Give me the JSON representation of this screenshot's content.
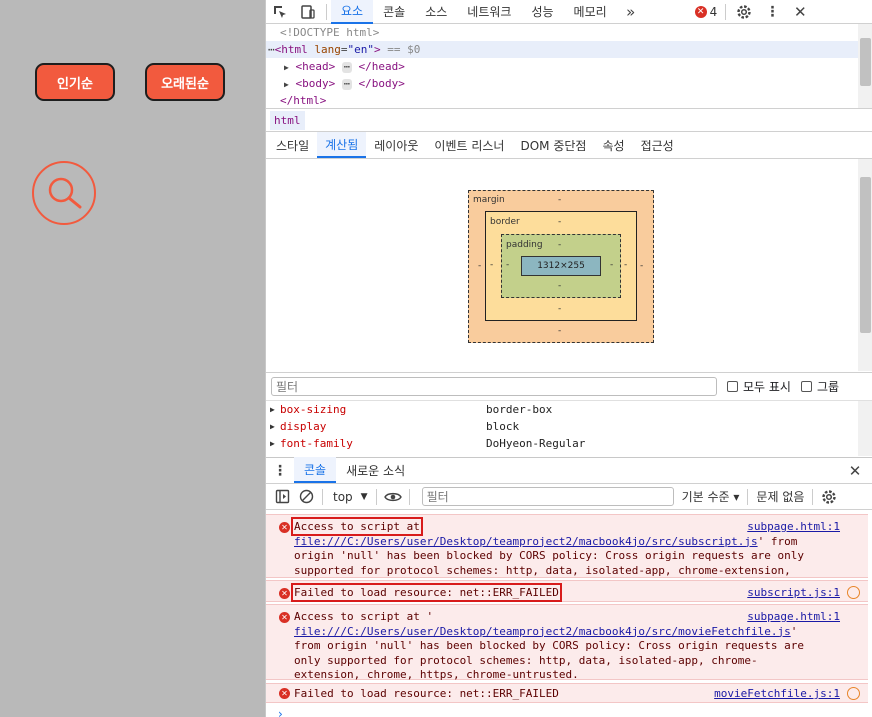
{
  "page": {
    "buttons": [
      {
        "label": "인기순"
      },
      {
        "label": "오래된순"
      }
    ]
  },
  "devtools": {
    "main_tabs": [
      "요소",
      "콘솔",
      "소스",
      "네트워크",
      "성능",
      "메모리"
    ],
    "active_main_tab": "요소",
    "more_tabs_glyph": "»",
    "error_count": "4",
    "dom": {
      "doctype": "<!DOCTYPE html>",
      "html_open_prefix": "<html ",
      "html_attr_name": "lang",
      "html_attr_value": "\"en\"",
      "html_open_suffix": ">",
      "html_marker": "== $0",
      "head_open": "<head>",
      "head_close": "</head>",
      "body_open": "<body>",
      "body_close": "</body>",
      "html_close": "</html>",
      "ellipsis": "⋯"
    },
    "breadcrumb": "html",
    "sub_tabs": [
      "스타일",
      "계산됨",
      "레이아웃",
      "이벤트 리스너",
      "DOM 중단점",
      "속성",
      "접근성"
    ],
    "active_sub_tab": "계산됨",
    "box_model": {
      "margin_label": "margin",
      "border_label": "border",
      "padding_label": "padding",
      "dash": "-",
      "content_size": "1312×255"
    },
    "computed_filter_placeholder": "필터",
    "show_all_label": "모두 표시",
    "group_label": "그룹",
    "properties": [
      {
        "name": "box-sizing",
        "value": "border-box"
      },
      {
        "name": "display",
        "value": "block"
      },
      {
        "name": "font-family",
        "value": "DoHyeon-Regular"
      }
    ],
    "drawer_tabs": [
      "콘솔",
      "새로운 소식"
    ],
    "active_drawer_tab": "콘솔",
    "console_toolbar": {
      "context": "top",
      "filter_placeholder": "필터",
      "levels": "기본 수준 ▾",
      "issues": "문제 없음"
    },
    "messages": [
      {
        "first": "Access to script at",
        "link": "file:///C:/Users/user/Desktop/teamproject2/macbook4jo/src/subscript.js",
        "rest": "' from origin 'null' has been blocked by CORS policy: Cross origin requests are only supported for protocol schemes: http, data, isolated-app, chrome-extension, chrome, https, chrome-untrusted.",
        "source": "subpage.html:1"
      },
      {
        "first": "Failed to load resource: net::ERR_FAILED",
        "source": "subscript.js:1"
      },
      {
        "first": "Access to script at '",
        "link": "file:///C:/Users/user/Desktop/teamproject2/macbook4jo/src/movieFetchfile.js",
        "rest": "' from origin 'null' has been blocked by CORS policy: Cross origin requests are only supported for protocol schemes: http, data, isolated-app, chrome-extension, chrome, https, chrome-untrusted.",
        "source": "subpage.html:1"
      },
      {
        "first": "Failed to load resource: net::ERR_FAILED",
        "source": "movieFetchfile.js:1"
      }
    ],
    "prompt": "›"
  },
  "colors": {
    "accent_orange": "#f25a3e",
    "devtools_blue": "#1a73e8",
    "error_red": "#d93025",
    "highlight_red": "#d81b1b"
  }
}
